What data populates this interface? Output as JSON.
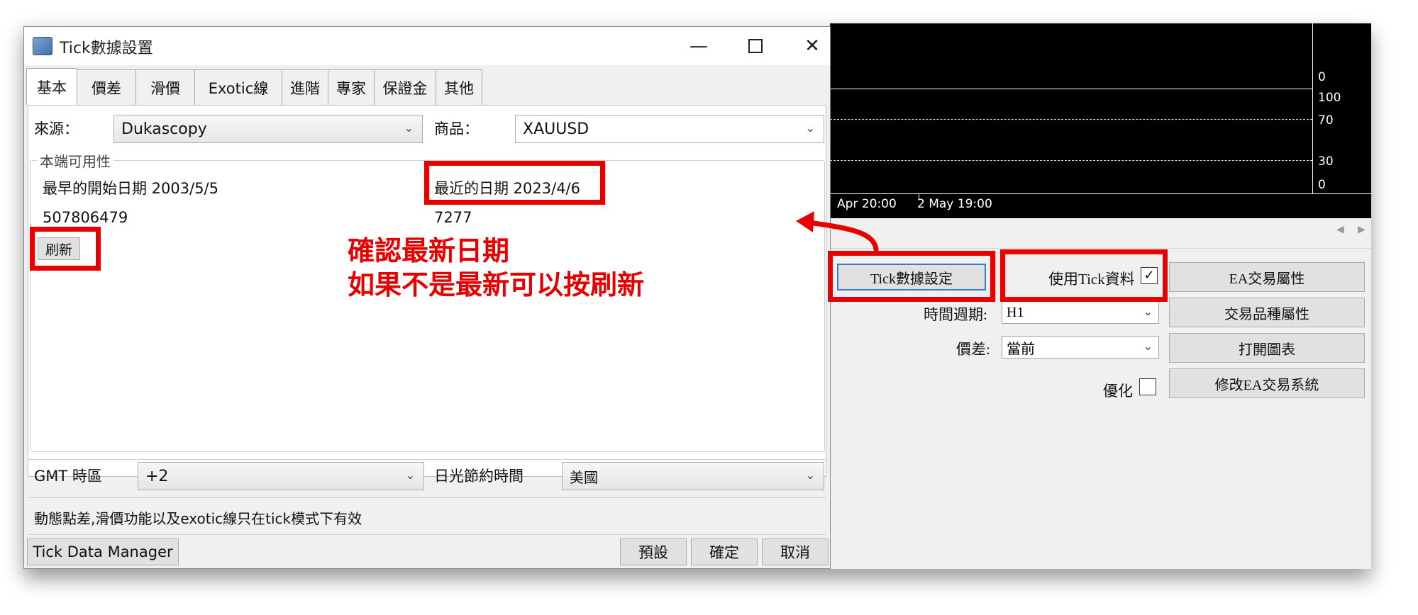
{
  "chart": {
    "y_labels": [
      "0",
      "100",
      "70",
      "30",
      "0"
    ],
    "x_labels": [
      "Apr 20:00",
      "2 May 19:00"
    ]
  },
  "tester": {
    "tick_settings_button": "Tick數據設定",
    "use_tick_label": "使用Tick資料",
    "use_tick_checked": "✓",
    "ea_properties_button": "EA交易屬性",
    "period_label": "時間週期:",
    "period_value": "H1",
    "symbol_properties_button": "交易品種屬性",
    "spread_label": "價差:",
    "spread_value": "當前",
    "open_chart_button": "打開圖表",
    "optimize_label": "優化",
    "modify_ea_button": "修改EA交易系統"
  },
  "dialog": {
    "title": "Tick數據設置",
    "tabs": [
      "基本",
      "價差",
      "滑價",
      "Exotic線",
      "進階",
      "專家",
      "保證金",
      "其他"
    ],
    "source_label": "來源：",
    "source_value": "Dukascopy",
    "symbol_label": "商品：",
    "symbol_value": "XAUUSD",
    "group_title": "本端可用性",
    "earliest_label": "最早的開始日期 2003/5/5",
    "latest_label": "最近的日期 2023/4/6",
    "earliest_count": "507806479",
    "latest_count": "7277",
    "refresh_button": "刷新",
    "gmt_label": "GMT 時區",
    "gmt_value": "+2",
    "dst_label": "日光節約時間",
    "dst_value": "美國",
    "note": "動態點差,滑價功能以及exotic線只在tick模式下有效",
    "manager_button": "Tick Data Manager",
    "default_button": "預設",
    "ok_button": "確定",
    "cancel_button": "取消"
  },
  "annotation": {
    "line1": "確認最新日期",
    "line2": "如果不是最新可以按刷新"
  },
  "colors": {
    "highlight": "#e80000",
    "chart_bg": "#000000"
  }
}
